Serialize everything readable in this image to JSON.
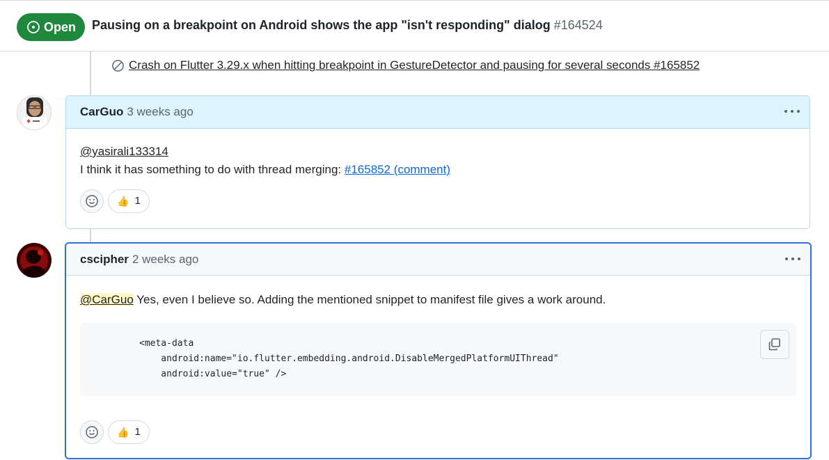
{
  "issue": {
    "state_label": "Open",
    "title": "Pausing on a breakpoint on Android shows the app \"isn't responding\" dialog",
    "number": "#164524"
  },
  "reference": {
    "text": "Crash on Flutter 3.29.x when hitting breakpoint in GestureDetector and pausing for several seconds #165852"
  },
  "comments": [
    {
      "author": "CarGuo",
      "time": "3 weeks ago",
      "mention": "@yasirali133314",
      "text": "I think it has something to do with thread merging: ",
      "link": "#165852 (comment)",
      "reaction": {
        "emoji": "👍",
        "count": "1"
      }
    },
    {
      "author": "cscipher",
      "time": "2 weeks ago",
      "mention": "@CarGuo",
      "text": " Yes, even I believe so. Adding the mentioned snippet to manifest file gives a work around.",
      "code_lines": [
        "<meta-data",
        "    android:name=\"io.flutter.embedding.android.DisableMergedPlatformUIThread\"",
        "    android:value=\"true\" />"
      ],
      "reaction": {
        "emoji": "👍",
        "count": "1"
      }
    }
  ],
  "colors": {
    "open_badge": "#1f883d",
    "header_highlight": "#ddf4ff",
    "focus_border": "#2f6fd6",
    "link": "#0969da"
  }
}
